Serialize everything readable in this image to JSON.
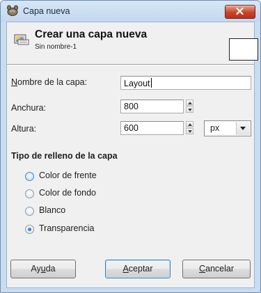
{
  "window": {
    "title": "Capa nueva",
    "close_icon": "close-icon"
  },
  "header": {
    "title": "Crear una capa nueva",
    "subtitle": "Sin nombre-1",
    "icon": "new-layer-icon"
  },
  "form": {
    "name_label_mnemonic": "N",
    "name_label_rest": "ombre de la capa:",
    "name_value": "Layout",
    "width_label": "Anchura:",
    "width_value": "800",
    "height_label": "Altura:",
    "height_value": "600",
    "unit_value": "px"
  },
  "fill": {
    "title": "Tipo de relleno de la capa",
    "options": [
      {
        "label": "Color de frente",
        "checked": false
      },
      {
        "label": "Color de fondo",
        "checked": false
      },
      {
        "label": "Blanco",
        "checked": false
      },
      {
        "label": "Transparencia",
        "checked": true
      }
    ]
  },
  "buttons": {
    "help_pre": "Ay",
    "help_mnemonic": "u",
    "help_post": "da",
    "ok_mnemonic": "A",
    "ok_rest": "ceptar",
    "cancel_mnemonic": "C",
    "cancel_rest": "ancelar"
  },
  "colors": {
    "frame": "#c9dcf0",
    "close_button": "#c9442b",
    "default_button_border": "#3c7fb1"
  }
}
